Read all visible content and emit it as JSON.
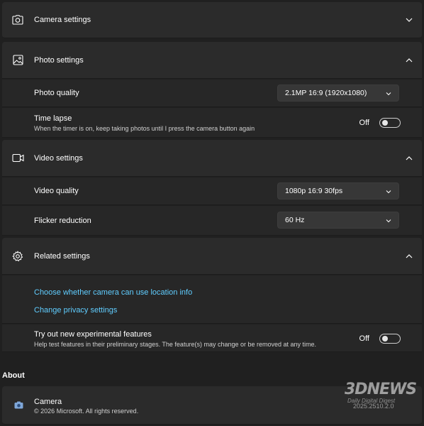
{
  "camera_settings": {
    "title": "Camera settings"
  },
  "photo_settings": {
    "title": "Photo settings",
    "photo_quality": {
      "label": "Photo quality",
      "value": "2.1MP 16:9 (1920x1080)"
    },
    "time_lapse": {
      "label": "Time lapse",
      "description": "When the timer is on, keep taking photos until I press the camera button again",
      "state": "Off"
    }
  },
  "video_settings": {
    "title": "Video settings",
    "video_quality": {
      "label": "Video quality",
      "value": "1080p 16:9 30fps"
    },
    "flicker_reduction": {
      "label": "Flicker reduction",
      "value": "60 Hz"
    }
  },
  "related_settings": {
    "title": "Related settings",
    "links": [
      "Choose whether camera can use location info",
      "Change privacy settings"
    ],
    "experimental": {
      "label": "Try out new experimental features",
      "description": "Help test features in their preliminary stages. The feature(s) may change or be removed at any time.",
      "state": "Off"
    }
  },
  "about": {
    "heading": "About",
    "app_name": "Camera",
    "copyright": "© 2026 Microsoft. All rights reserved.",
    "version": "2025.2510.2.0"
  },
  "watermark": {
    "brand": "3DNEWS",
    "tagline": "Daily Digital Digest"
  },
  "colors": {
    "background": "#202020",
    "card": "#2b2b2b",
    "link": "#60cdff"
  }
}
